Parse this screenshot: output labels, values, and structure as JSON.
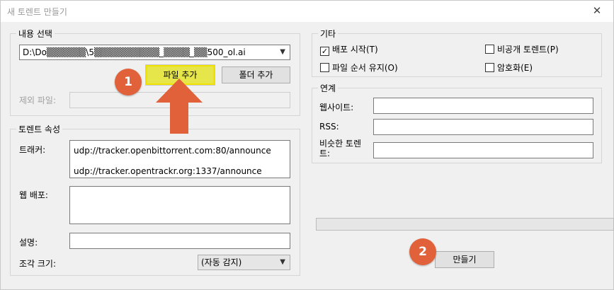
{
  "window": {
    "title": "새 토렌트 만들기",
    "close_glyph": "✕"
  },
  "content": {
    "group_title": "내용 선택",
    "path_value": "D:\\Do▒▒▒▒▒▒\\5▒▒▒▒▒▒▒▒▒▒_▒▒▒▒_▒▒500_ol.ai",
    "add_file_label": "파일 추가",
    "add_folder_label": "폴더 추가",
    "exclude_label": "제외 파일:",
    "exclude_value": ""
  },
  "torrent": {
    "group_title": "토렌트 속성",
    "tracker_label": "트래커:",
    "trackers": [
      "udp://tracker.openbittorrent.com:80/announce",
      "udp://tracker.opentrackr.org:1337/announce"
    ],
    "web_seed_label": "웹 배포:",
    "web_seed_value": "",
    "comment_label": "설명:",
    "comment_value": "",
    "piece_size_label": "조각 크기:",
    "piece_size_value": "(자동 감지)"
  },
  "other": {
    "group_title": "기타",
    "options": [
      {
        "label": "배포 시작(T)",
        "checked": true
      },
      {
        "label": "비공개 토렌트(P)",
        "checked": false
      },
      {
        "label": "파일 순서 유지(O)",
        "checked": false
      },
      {
        "label": "암호화(E)",
        "checked": false
      }
    ]
  },
  "links": {
    "group_title": "연계",
    "website_label": "웹사이트:",
    "website_value": "",
    "rss_label": "RSS:",
    "rss_value": "",
    "similar_label_line1": "비슷한 토렌",
    "similar_label_line2": "트:",
    "similar_value": ""
  },
  "progress": {
    "value": 0
  },
  "create_label": "만들기",
  "annotations": {
    "step1": "1",
    "step2": "2",
    "arrow_color": "#e0613a",
    "highlight_color": "#e6e64a"
  }
}
